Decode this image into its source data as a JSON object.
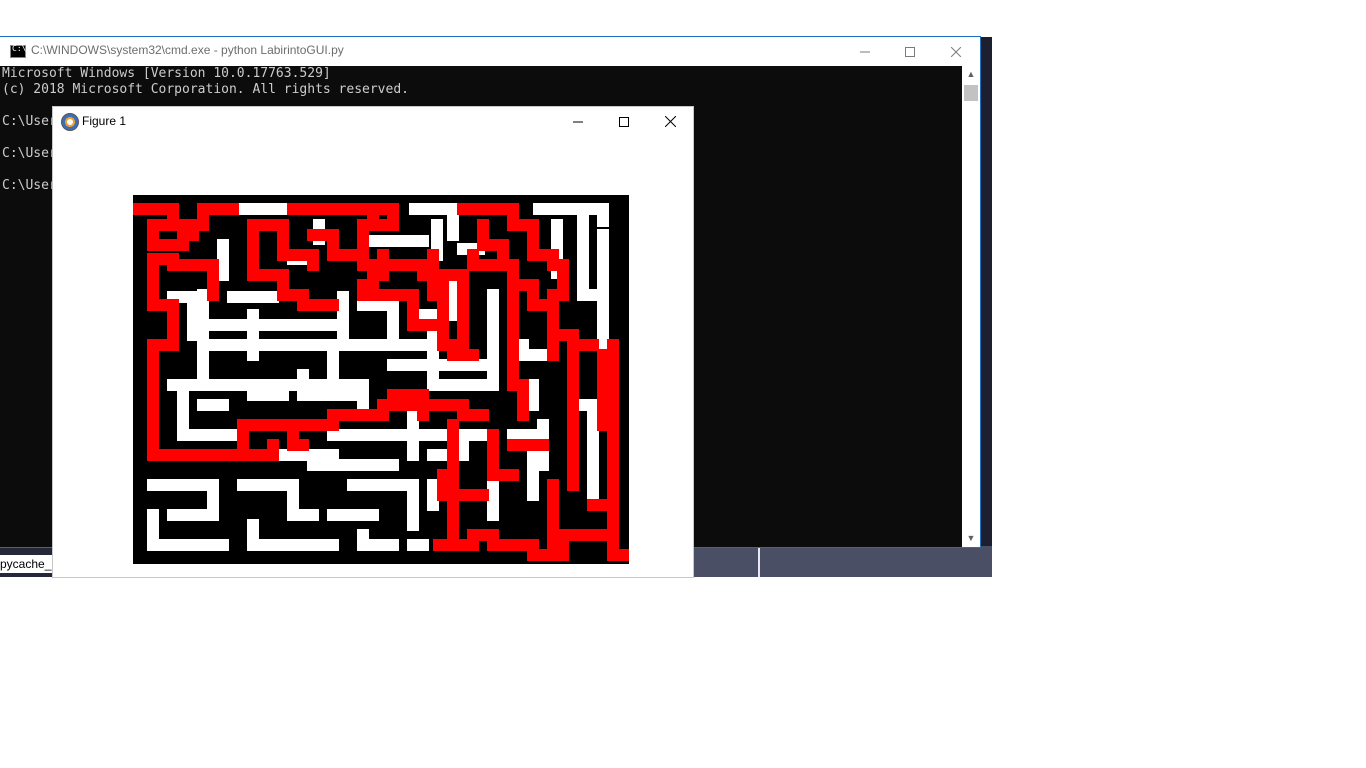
{
  "cmd": {
    "title": "C:\\WINDOWS\\system32\\cmd.exe - python  LabirintoGUI.py",
    "lines": [
      "Microsoft Windows [Version 10.0.17763.529]",
      "(c) 2018 Microsoft Corporation. All rights reserved.",
      "",
      "C:\\User",
      "",
      "C:\\User",
      "",
      "C:\\User"
    ]
  },
  "figure": {
    "title": "Figure 1"
  },
  "desktop": {
    "folder_label": "pycache_"
  },
  "icons": {
    "minimize": "minimize-icon",
    "maximize": "maximize-icon",
    "close": "close-icon"
  },
  "colors": {
    "wall": "#000000",
    "path": "#ffffff",
    "solution": "#ff0000"
  }
}
